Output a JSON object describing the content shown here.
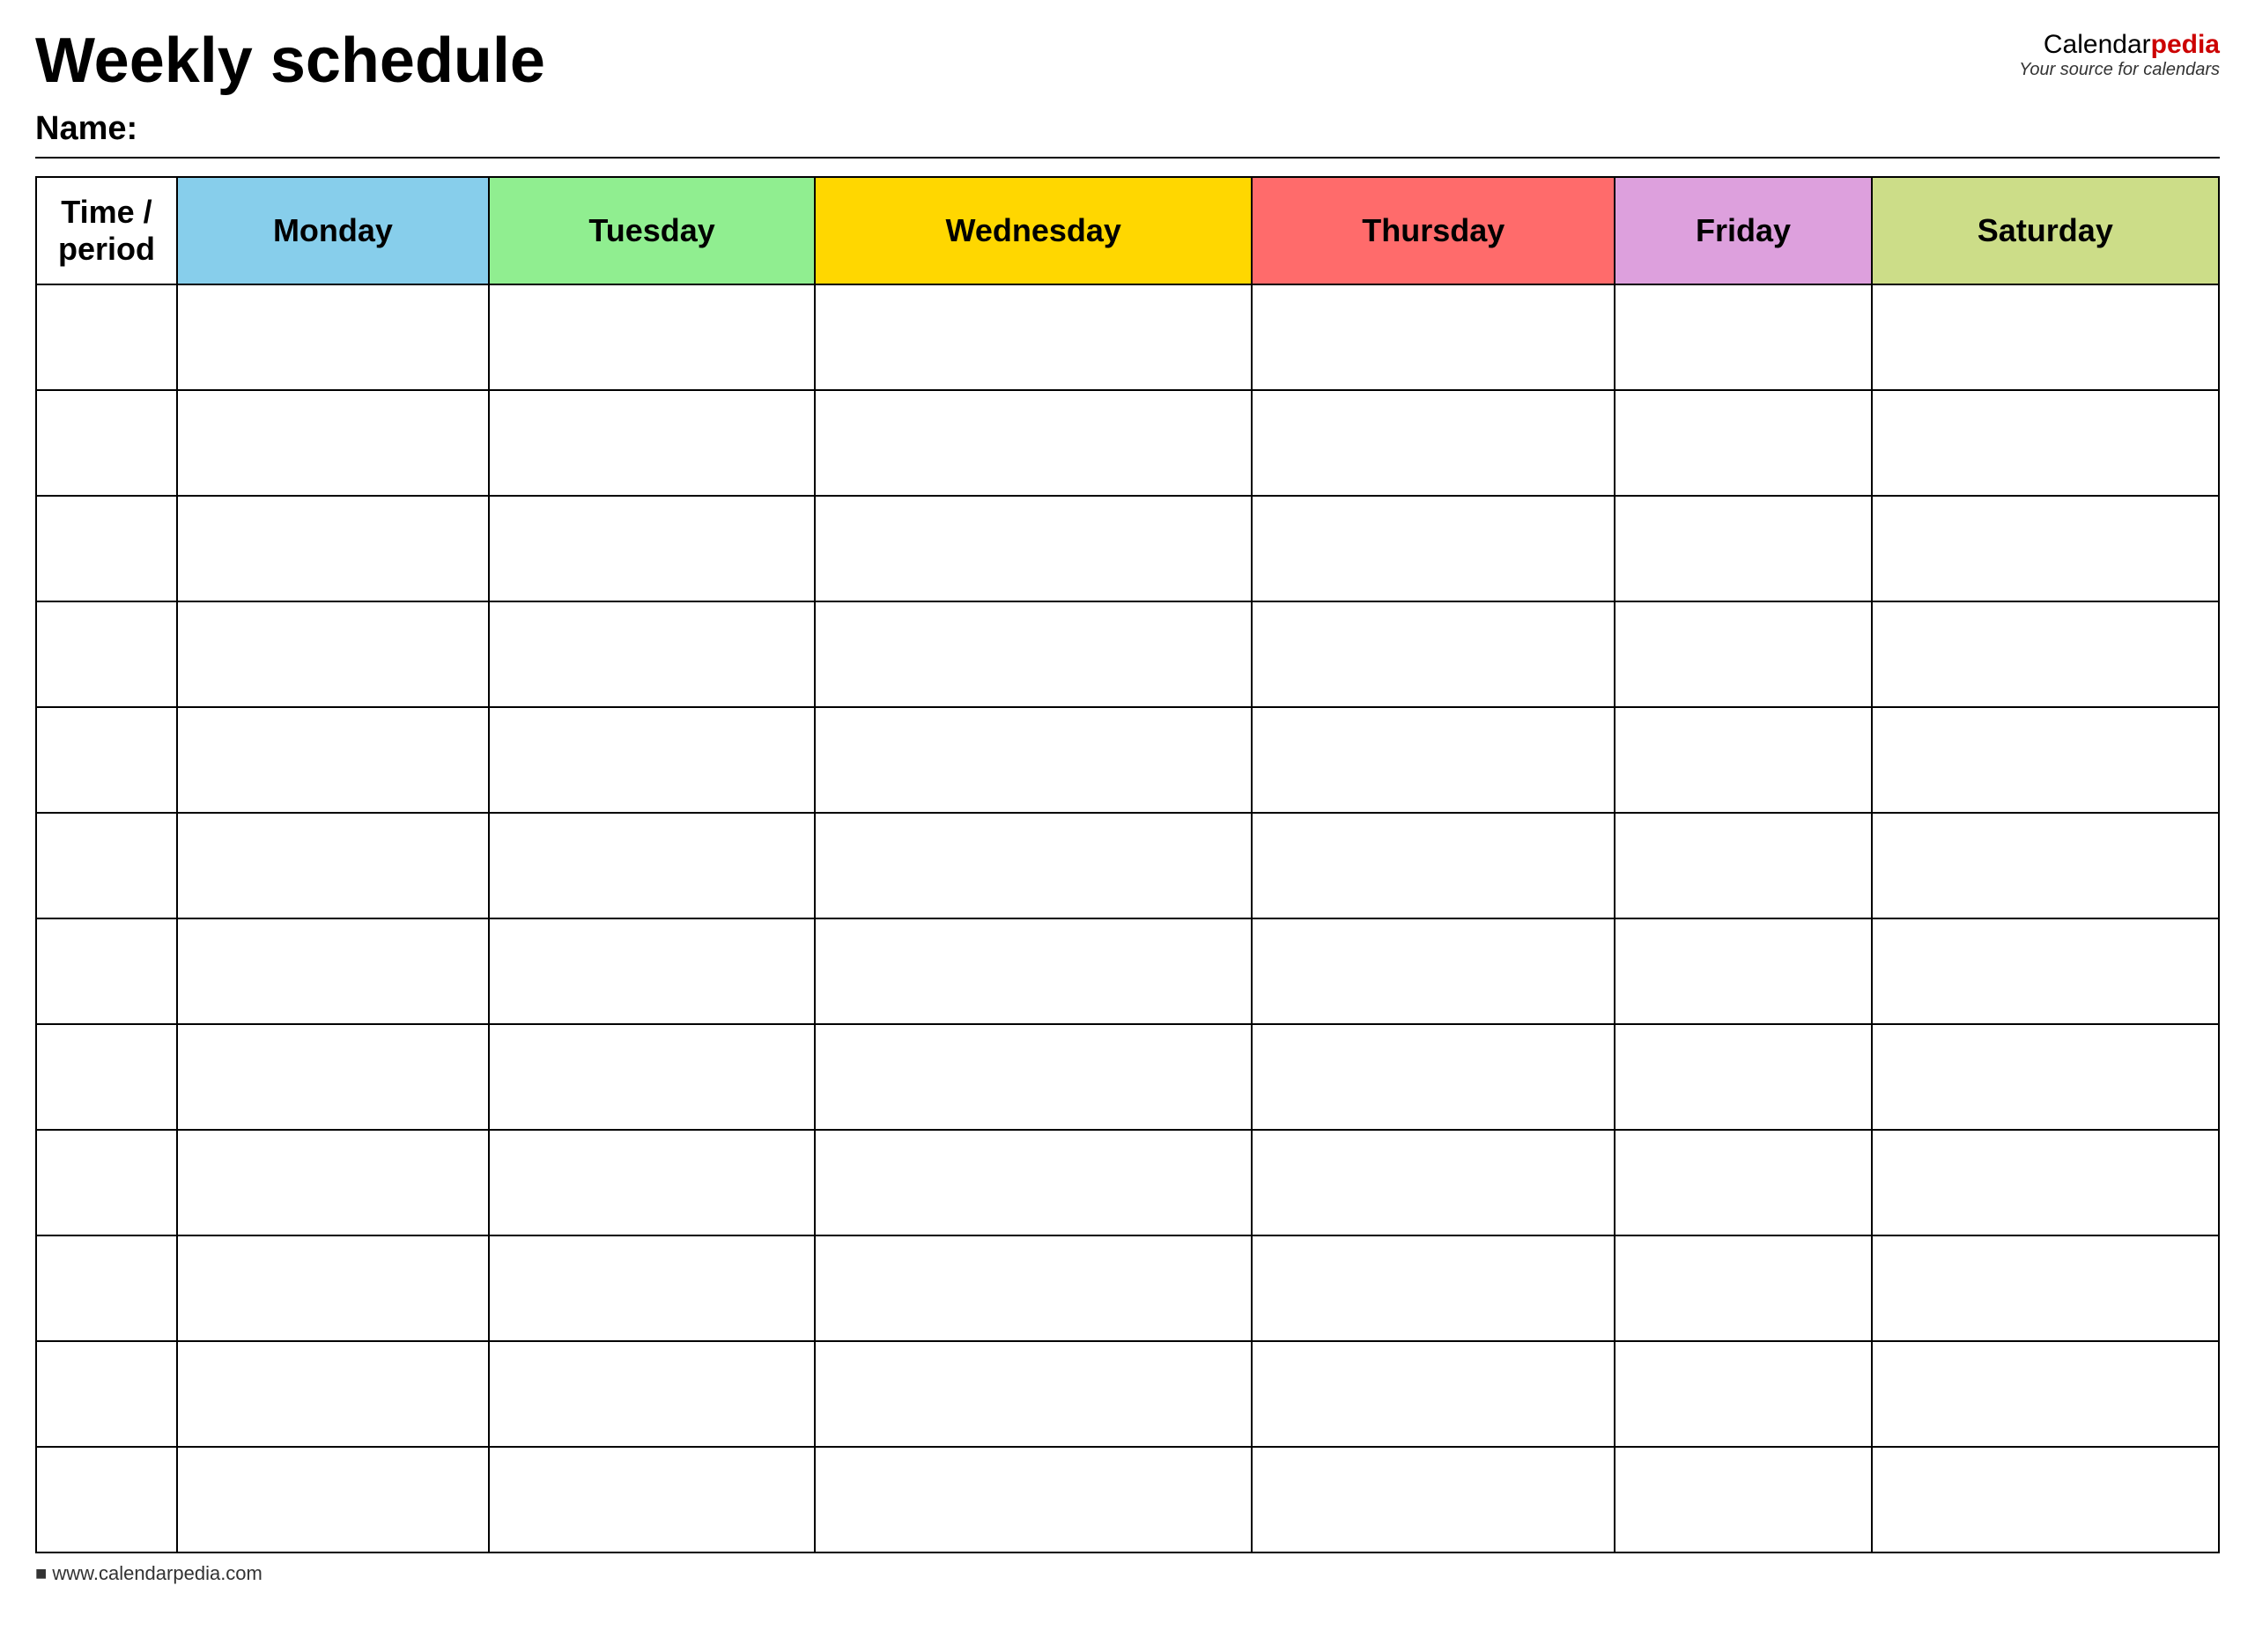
{
  "header": {
    "title": "Weekly schedule",
    "name_label": "Name:",
    "logo_calendar": "Calendar",
    "logo_pedia": "pedia",
    "logo_tagline": "Your source for calendars"
  },
  "table": {
    "columns": [
      {
        "id": "time",
        "label": "Time / period",
        "color_class": "col-time"
      },
      {
        "id": "monday",
        "label": "Monday",
        "color_class": "col-monday"
      },
      {
        "id": "tuesday",
        "label": "Tuesday",
        "color_class": "col-tuesday"
      },
      {
        "id": "wednesday",
        "label": "Wednesday",
        "color_class": "col-wednesday"
      },
      {
        "id": "thursday",
        "label": "Thursday",
        "color_class": "col-thursday"
      },
      {
        "id": "friday",
        "label": "Friday",
        "color_class": "col-friday"
      },
      {
        "id": "saturday",
        "label": "Saturday",
        "color_class": "col-saturday"
      }
    ],
    "row_count": 12
  },
  "footer": {
    "url": "www.calendarpedia.com"
  }
}
